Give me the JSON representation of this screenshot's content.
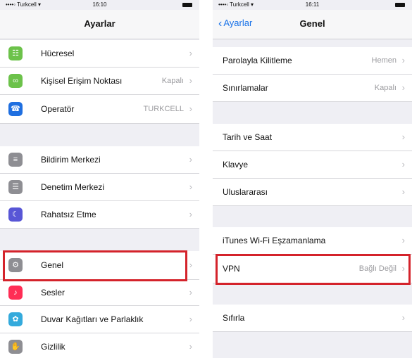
{
  "left": {
    "status": {
      "carrier": "••••◦ Turkcell ▾",
      "time": "16:10"
    },
    "title": "Ayarlar",
    "rows": [
      {
        "label": "Hücresel",
        "value": ""
      },
      {
        "label": "Kişisel Erişim Noktası",
        "value": "Kapalı"
      },
      {
        "label": "Operatör",
        "value": "TURKCELL"
      },
      {
        "label": "Bildirim Merkezi",
        "value": ""
      },
      {
        "label": "Denetim Merkezi",
        "value": ""
      },
      {
        "label": "Rahatsız Etme",
        "value": ""
      },
      {
        "label": "Genel",
        "value": ""
      },
      {
        "label": "Sesler",
        "value": ""
      },
      {
        "label": "Duvar Kağıtları ve Parlaklık",
        "value": ""
      },
      {
        "label": "Gizlilik",
        "value": ""
      }
    ]
  },
  "right": {
    "status": {
      "carrier": "••••◦ Turkcell ▾",
      "time": "16:11"
    },
    "back_label": "Ayarlar",
    "title": "Genel",
    "rows": [
      {
        "label": "Parolayla Kilitleme",
        "value": "Hemen"
      },
      {
        "label": "Sınırlamalar",
        "value": "Kapalı"
      },
      {
        "label": "Tarih ve Saat",
        "value": ""
      },
      {
        "label": "Klavye",
        "value": ""
      },
      {
        "label": "Uluslararası",
        "value": ""
      },
      {
        "label": "iTunes Wi-Fi Eşzamanlama",
        "value": ""
      },
      {
        "label": "VPN",
        "value": "Bağlı Değil"
      },
      {
        "label": "Sıfırla",
        "value": ""
      }
    ]
  },
  "icons": {
    "cellular": {
      "color": "#6cc24a",
      "glyph": "☷"
    },
    "hotspot": {
      "color": "#6cc24a",
      "glyph": "∞"
    },
    "carrier": {
      "color": "#1f6fe0",
      "glyph": "☎"
    },
    "notification-center": {
      "color": "#8e8e93",
      "glyph": "≡"
    },
    "control-center": {
      "color": "#8e8e93",
      "glyph": "☰"
    },
    "do-not-disturb": {
      "color": "#5856d6",
      "glyph": "☾"
    },
    "general": {
      "color": "#8e8e93",
      "glyph": "⚙"
    },
    "sounds": {
      "color": "#ff2d55",
      "glyph": "♪"
    },
    "wallpaper": {
      "color": "#34aadc",
      "glyph": "✿"
    },
    "privacy": {
      "color": "#8e8e93",
      "glyph": "✋"
    }
  },
  "colors": {
    "accent": "#1a73e8",
    "highlight": "#d4232b"
  },
  "chevron": "›"
}
